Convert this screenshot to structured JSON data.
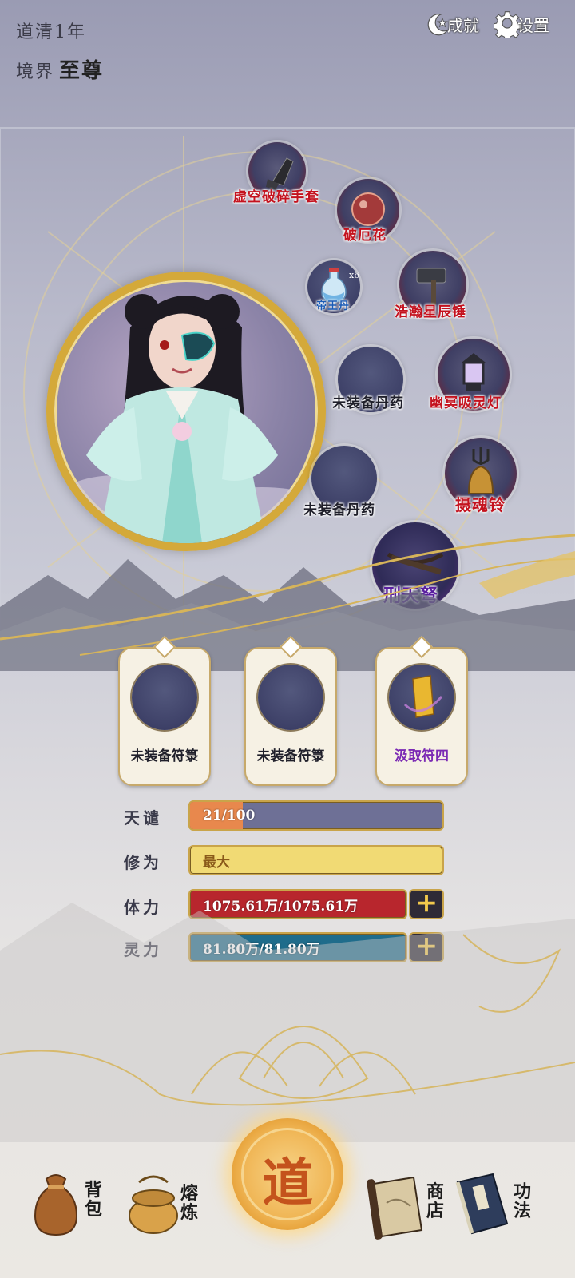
{
  "header": {
    "era": "道清1年",
    "realm_label": "境界",
    "realm_value": "至尊",
    "achievements_label": "成就",
    "settings_label": "设置"
  },
  "equipment": {
    "gloves": "虚空破碎手套",
    "flower": "破厄花",
    "pill_slot": "帝王丹",
    "pill_count": "x6",
    "hammer": "浩瀚星辰锤",
    "empty_pill_1": "未装备丹药",
    "lamp": "幽冥吸灵灯",
    "empty_pill_2": "未装备丹药",
    "bell": "摄魂铃",
    "crossbow": "刑天弩"
  },
  "talismans": [
    {
      "label": "未装备符箓"
    },
    {
      "label": "未装备符箓"
    },
    {
      "label": "汲取符四"
    }
  ],
  "stats": {
    "tianqian_label": "天谴",
    "tianqian_value": "21/100",
    "tianqian_fraction": 0.21,
    "xiuwei_label": "修为",
    "xiuwei_value": "最大",
    "tili_label": "体力",
    "tili_value": "1075.61万/1075.61万",
    "lingli_label": "灵力",
    "lingli_value": "81.80万/81.80万"
  },
  "nav": {
    "bag": "背包",
    "smelt": "熔炼",
    "dao": "道",
    "shop": "商店",
    "skills": "功法"
  },
  "colors": {
    "gold": "#d4a93a",
    "hp_red": "#b8262d",
    "mp_teal": "#1f6c8b",
    "exp_yellow": "#f1da74",
    "tq_bar": "#6e7096",
    "tq_fill": "#e8884d"
  }
}
